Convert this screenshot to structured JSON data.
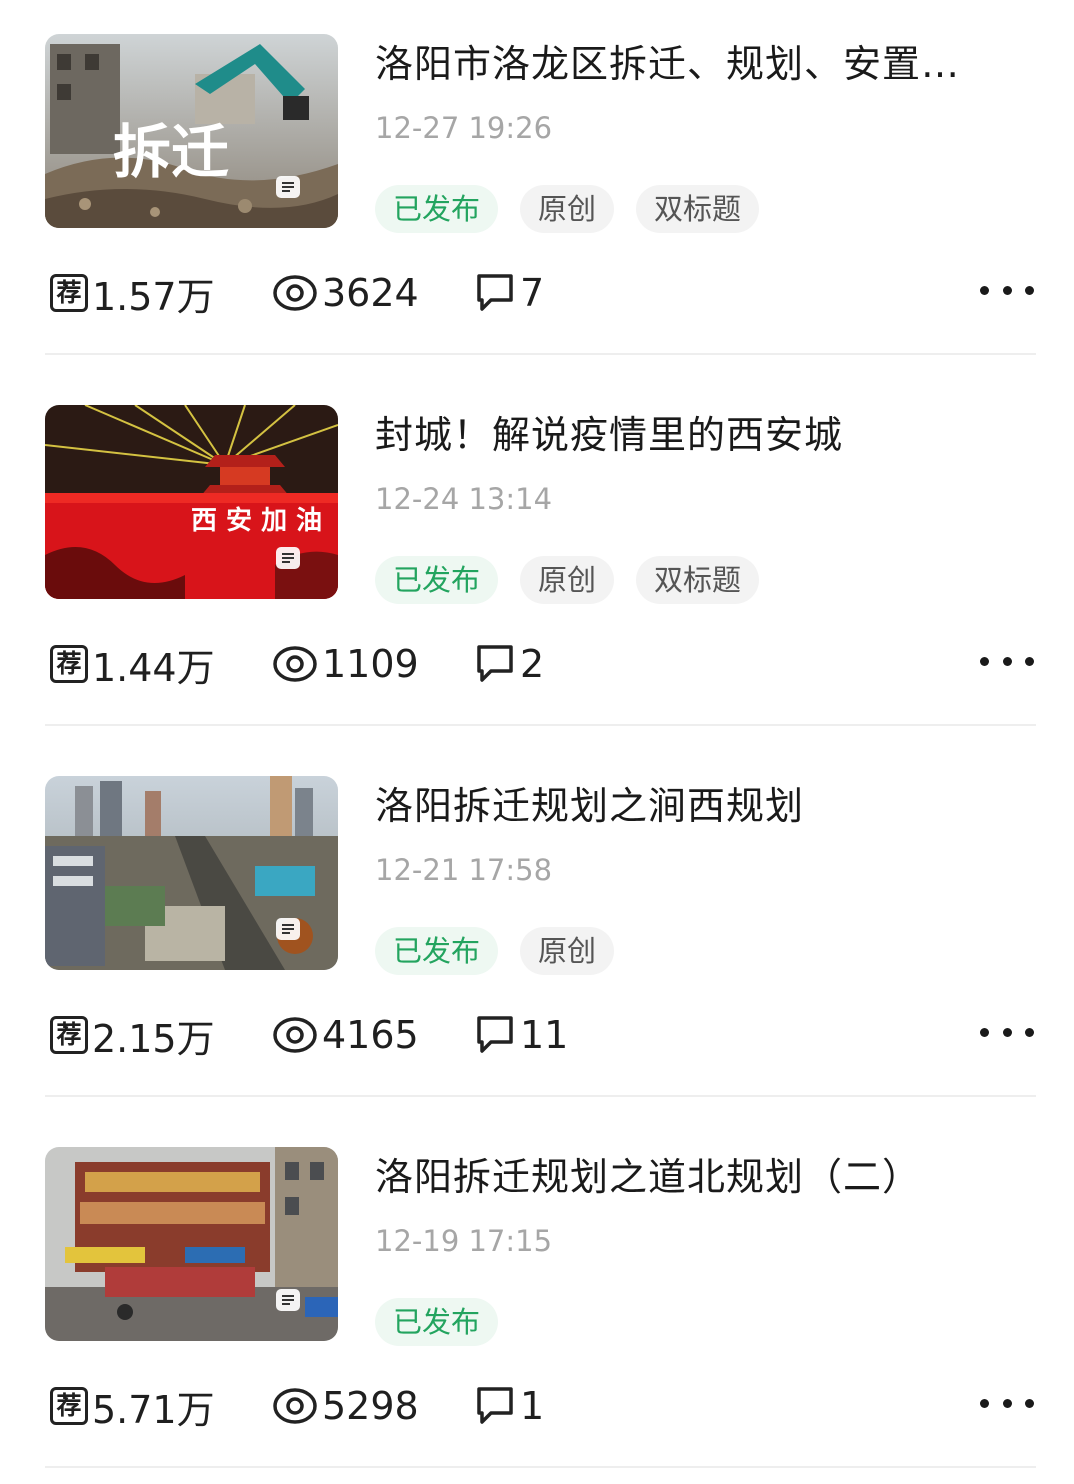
{
  "colors": {
    "published_tag_text": "#23a45f",
    "published_tag_bg": "#eef8f2",
    "plain_tag_bg": "#f3f3f3",
    "date_text": "#a6a6a6"
  },
  "articles": [
    {
      "title": "洛阳市洛龙区拆迁、规划、安置…",
      "date": "12-27 19:26",
      "tags": [
        "已发布",
        "原创",
        "双标题"
      ],
      "thumbnail_icon": "article-doc-icon",
      "thumbnail_text": "拆迁",
      "recommend_icon": "荐",
      "recommendations": "1.57万",
      "views": "3624",
      "comments": "7"
    },
    {
      "title": "封城！解说疫情里的西安城",
      "date": "12-24 13:14",
      "tags": [
        "已发布",
        "原创",
        "双标题"
      ],
      "thumbnail_icon": "article-doc-icon",
      "thumbnail_text": "西 安 加 油",
      "recommend_icon": "荐",
      "recommendations": "1.44万",
      "views": "1109",
      "comments": "2"
    },
    {
      "title": "洛阳拆迁规划之涧西规划",
      "date": "12-21 17:58",
      "tags": [
        "已发布",
        "原创"
      ],
      "thumbnail_icon": "article-doc-icon",
      "thumbnail_text": "",
      "recommend_icon": "荐",
      "recommendations": "2.15万",
      "views": "4165",
      "comments": "11"
    },
    {
      "title": "洛阳拆迁规划之道北规划（二）",
      "date": "12-19 17:15",
      "tags": [
        "已发布"
      ],
      "thumbnail_icon": "article-doc-icon",
      "thumbnail_text": "",
      "recommend_icon": "荐",
      "recommendations": "5.71万",
      "views": "5298",
      "comments": "1"
    }
  ]
}
